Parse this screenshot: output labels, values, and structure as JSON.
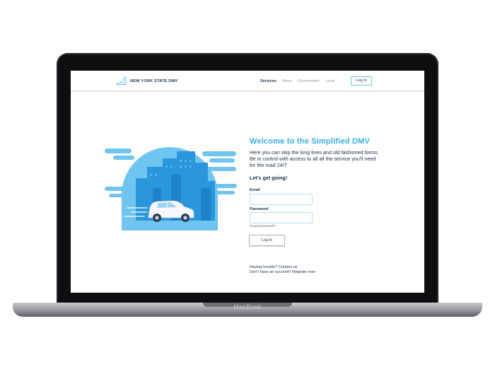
{
  "device": {
    "brand": "MacBook"
  },
  "nav": {
    "logo_text": "NEW YORK STATE DMV",
    "links": [
      {
        "label": "Services",
        "active": true
      },
      {
        "label": "News",
        "active": false
      },
      {
        "label": "Government",
        "active": false
      },
      {
        "label": "Local",
        "active": false
      }
    ],
    "login_label": "Log In"
  },
  "main": {
    "title": "Welcome to the Simplified DMV",
    "description": "Here you can skip the long lines and old fashioned forms. Be in control with access to all all the service you'll need for the road 24/7",
    "cta": "Let's get going!",
    "email_label": "Email",
    "email_value": "",
    "password_label": "Password",
    "password_value": "",
    "forgot_link": "Forgot password?",
    "login_button": "Log In",
    "trouble_link": "Having trouble? Contact us",
    "register_link": "Don't have an account? Register now"
  },
  "colors": {
    "accent": "#3aaee6",
    "text_dark": "#1b2f4a",
    "illustration_light": "#6fc5ef",
    "illustration_dark": "#1f8fd6"
  }
}
